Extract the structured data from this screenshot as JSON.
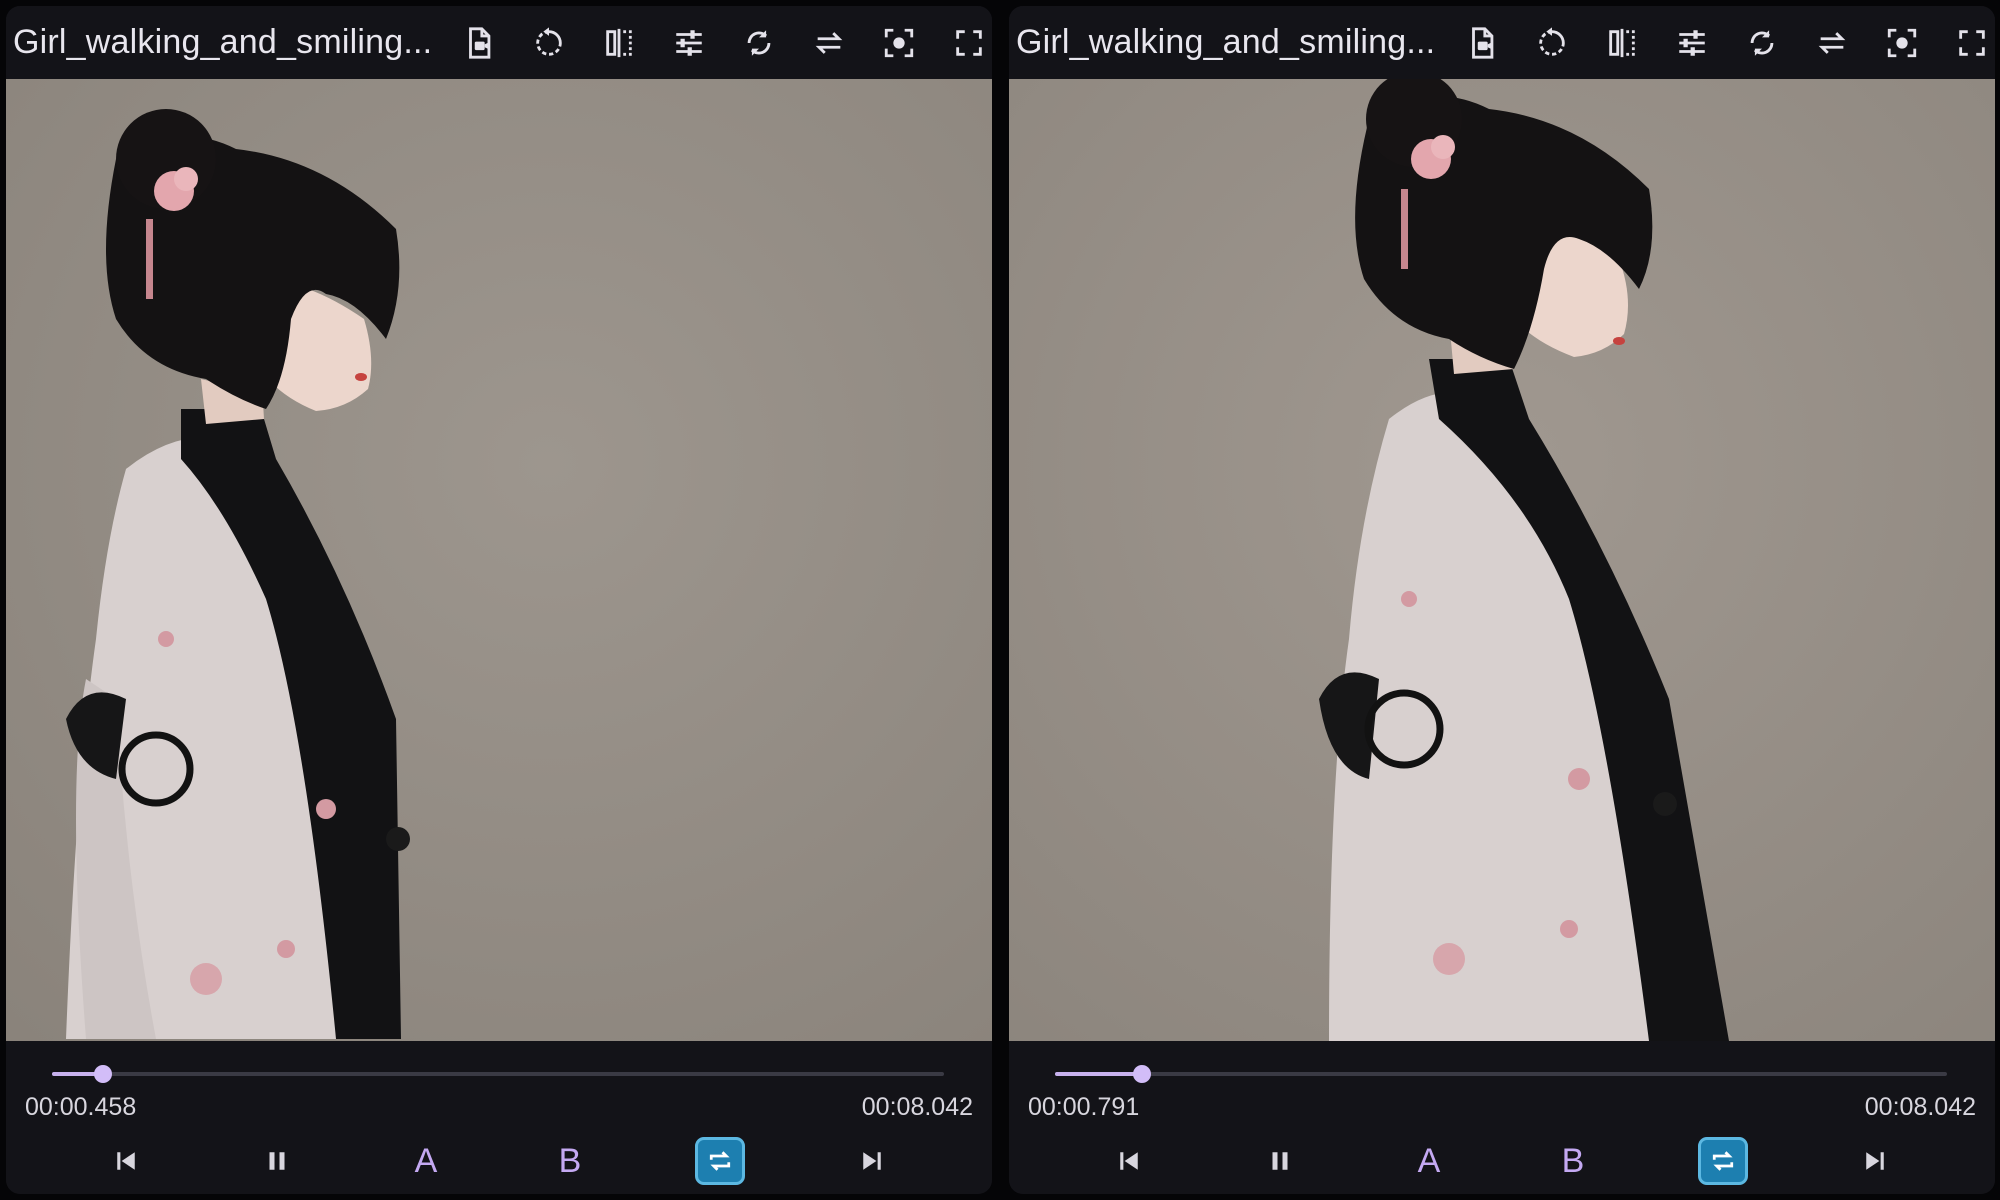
{
  "colors": {
    "accent": "#c7b1ee",
    "loop_active": "#1d7fb0",
    "background": "#131318",
    "video_backdrop": "#948d85"
  },
  "players": [
    {
      "title": "Girl_walking_and_smiling...",
      "toolbar": [
        "file-info-icon",
        "rotate-icon",
        "mirror-icon",
        "adjust-icon",
        "refresh-icon",
        "swap-icon",
        "screenshot-icon",
        "fullscreen-icon"
      ],
      "current_time": "00:00.458",
      "duration": "00:08.042",
      "progress_fraction": 0.057,
      "controls": {
        "a_label": "A",
        "b_label": "B"
      }
    },
    {
      "title": "Girl_walking_and_smiling...",
      "toolbar": [
        "file-info-icon",
        "rotate-icon",
        "mirror-icon",
        "adjust-icon",
        "refresh-icon",
        "swap-icon",
        "screenshot-icon",
        "fullscreen-icon"
      ],
      "current_time": "00:00.791",
      "duration": "00:08.042",
      "progress_fraction": 0.098,
      "controls": {
        "a_label": "A",
        "b_label": "B"
      }
    }
  ]
}
